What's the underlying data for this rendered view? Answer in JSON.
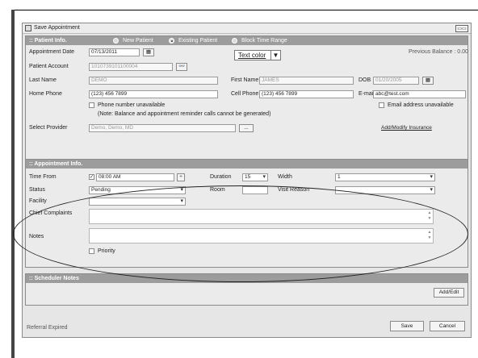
{
  "window": {
    "title": "Save Appointment",
    "max_label": "▭▭"
  },
  "patient": {
    "header": ":: Patient Info.",
    "radio_new": "New Patient",
    "radio_existing": "Existing Patient",
    "radio_block": "Block Time Range",
    "selected_radio": "Existing Patient",
    "appt_date_label": "Appointment Date",
    "appt_date": "07/13/2011",
    "text_color_label": "Text color",
    "prev_balance": "Previous Balance : 0.00",
    "account_label": "Patient Account",
    "account": "1010739101100004",
    "last_name_label": "Last Name",
    "last_name": "DEMO",
    "first_name_label": "First Name",
    "first_name": "JAMES",
    "dob_label": "DOB",
    "dob": "01/20/2005",
    "home_phone_label": "Home Phone",
    "home_phone": "(123) 456 7899",
    "cell_phone_label": "Cell Phone",
    "cell_phone": "(123) 456 7899",
    "email_label": "E-mail",
    "email": "abc@test.com",
    "phone_unavailable": "Phone number unavailable",
    "note": "(Note: Balance and appointment reminder calls cannot be generated)",
    "email_unavailable": "Email address unavailable",
    "provider_label": "Select Provider",
    "provider": "Demo, Demo, MD",
    "insurance_link": "Add/Modify Insurance"
  },
  "appointment": {
    "header": ":: Appointment Info.",
    "time_from_label": "Time From",
    "time_from": "08:00 AM",
    "duration_label": "Duration",
    "duration": "15",
    "width_label": "Width",
    "width": "1",
    "status_label": "Status",
    "status": "Pending",
    "room_label": "Room",
    "room": "",
    "visit_reason_label": "Visit Reason",
    "visit_reason": "",
    "facility_label": "Facility",
    "facility": "",
    "complaints_label": "Chief Complaints",
    "notes_label": "Notes",
    "priority_label": "Priority"
  },
  "scheduler": {
    "header": ":: Scheduler Notes",
    "addedit_label": "Add/Edit"
  },
  "footer": {
    "status": "Referral Expired",
    "save_label": "Save",
    "cancel_label": "Cancel"
  }
}
